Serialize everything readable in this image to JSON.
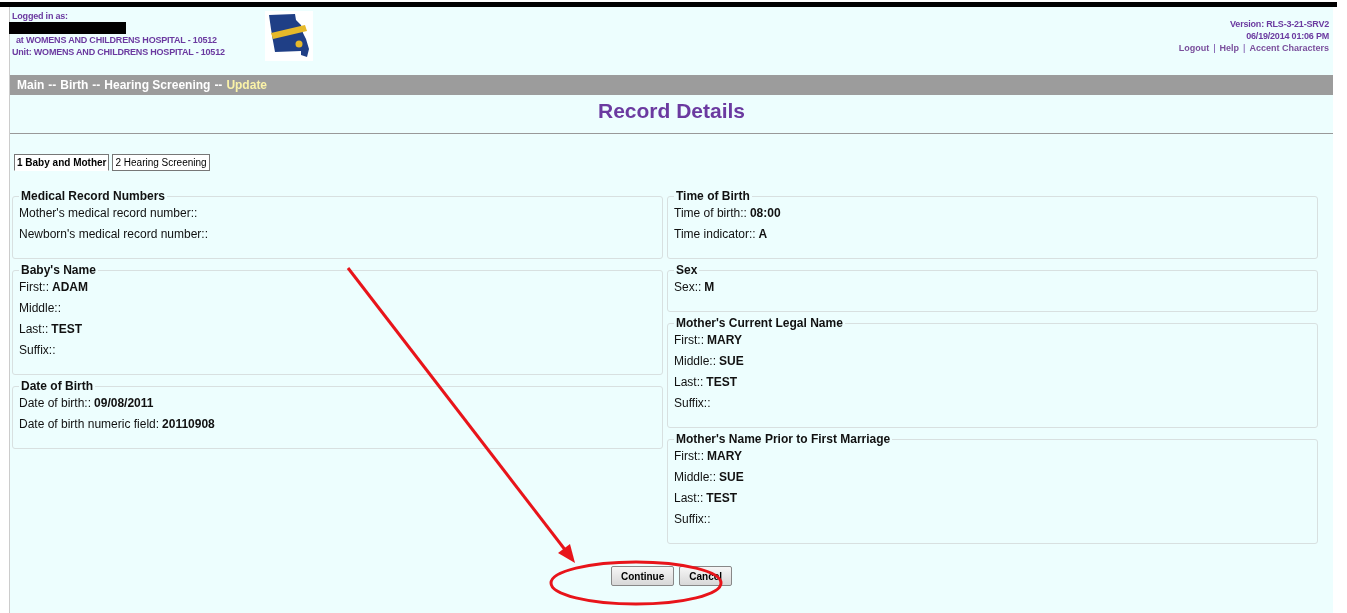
{
  "header": {
    "logged_in_label": "Logged in as:",
    "facility": "at WOMENS AND CHILDRENS HOSPITAL - 10512",
    "unit": "Unit: WOMENS AND CHILDRENS HOSPITAL - 10512",
    "version": "Version: RLS-3-21-SRV2",
    "datetime": "06/19/2014 01:06 PM",
    "links": [
      "Logout",
      "Help",
      "Accent Characters"
    ],
    "link_separator": "|"
  },
  "breadcrumb_separator": "--",
  "breadcrumb": [
    {
      "label": "Main",
      "current": false
    },
    {
      "label": "Birth",
      "current": false
    },
    {
      "label": "Hearing Screening",
      "current": false
    },
    {
      "label": "Update",
      "current": true
    }
  ],
  "title": "Record Details",
  "tabs": [
    {
      "label": "1 Baby and Mother",
      "selected": true
    },
    {
      "label": "2 Hearing Screening",
      "selected": false
    }
  ],
  "left_sections": [
    {
      "legend": "Medical Record Numbers",
      "fields": [
        {
          "label": "Mother's medical record number::"
        },
        {
          "label": "Newborn's medical record number::"
        }
      ]
    },
    {
      "legend": "Baby's Name",
      "fields": [
        {
          "label": "First::",
          "value": "ADAM"
        },
        {
          "label": "Middle::"
        },
        {
          "label": "Last::",
          "value": "TEST"
        },
        {
          "label": "Suffix::"
        }
      ]
    },
    {
      "legend": "Date of Birth",
      "fields": [
        {
          "label": "Date of birth::",
          "value": "09/08/2011"
        },
        {
          "label": "Date of birth numeric field:",
          "value": "20110908"
        }
      ]
    }
  ],
  "right_sections": [
    {
      "legend": "Time of Birth",
      "fields": [
        {
          "label": "Time of birth::",
          "value": "08:00"
        },
        {
          "label": "Time indicator::",
          "value": "A"
        }
      ]
    },
    {
      "legend": "Sex",
      "fields": [
        {
          "label": "Sex::",
          "value": "M"
        }
      ]
    },
    {
      "legend": "Mother's Current Legal Name",
      "fields": [
        {
          "label": "First::",
          "value": "MARY"
        },
        {
          "label": "Middle::",
          "value": "SUE"
        },
        {
          "label": "Last::",
          "value": "TEST"
        },
        {
          "label": "Suffix::"
        }
      ]
    },
    {
      "legend": "Mother's Name Prior to First Marriage",
      "fields": [
        {
          "label": "First::",
          "value": "MARY"
        },
        {
          "label": "Middle::",
          "value": "SUE"
        },
        {
          "label": "Last::",
          "value": "TEST"
        },
        {
          "label": "Suffix::"
        }
      ]
    }
  ],
  "buttons": [
    "Continue",
    "Cancel"
  ]
}
